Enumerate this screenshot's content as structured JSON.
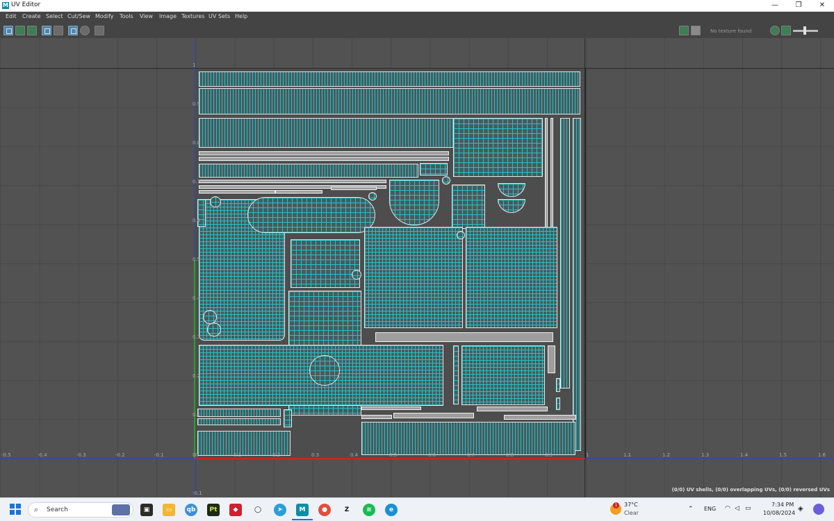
{
  "window": {
    "app_icon": "M",
    "title": "UV Editor",
    "minimize": "—",
    "restore": "❐",
    "close": "✕"
  },
  "menu": [
    "Edit",
    "Create",
    "Select",
    "Cut/Sew",
    "Modify",
    "Tools",
    "View",
    "Image",
    "Textures",
    "UV Sets",
    "Help"
  ],
  "toolbar": {
    "no_texture": "No texture found"
  },
  "axis": {
    "x_ticks": [
      "-0.5",
      "-0.4",
      "-0.3",
      "-0.2",
      "-0.1",
      "0",
      "0.1",
      "0.2",
      "0.3",
      "0.4",
      "0.5",
      "0.6",
      "0.7",
      "0.8",
      "0.9",
      "1",
      "1.1",
      "1.2",
      "1.3",
      "1.4",
      "1.5",
      "1.6"
    ],
    "y_ticks": [
      "1",
      "0.9",
      "0.8",
      "0.7",
      "0.6",
      "0.5",
      "0.4",
      "0.3",
      "0.2",
      "0.1",
      "0",
      "-0.1"
    ]
  },
  "status": "(0/0) UV shells, (0/0) overlapping UVs, (0/0) reversed UVs",
  "taskbar": {
    "search_placeholder": "Search",
    "weather_badge": "1",
    "temperature": "37°C",
    "condition": "Clear",
    "language": "ENG",
    "time": "7:34 PM",
    "date": "10/08/2024"
  }
}
